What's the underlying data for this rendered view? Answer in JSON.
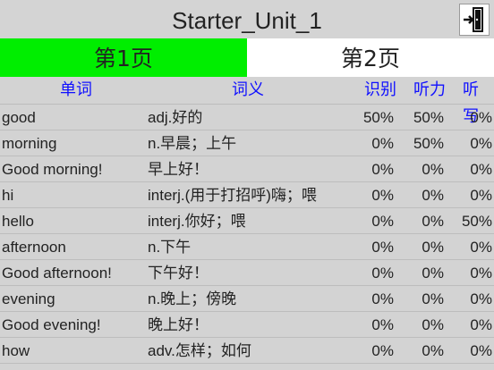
{
  "title": "Starter_Unit_1",
  "tabs": [
    {
      "label": "第1页",
      "active": true
    },
    {
      "label": "第2页",
      "active": false
    }
  ],
  "columns": {
    "word": "单词",
    "meaning": "词义",
    "recognize": "识别",
    "listening": "听力",
    "dictation": "听写"
  },
  "exit_icon": "exit-door-icon",
  "colors": {
    "active_tab": "#00ee00",
    "header_text": "#1010ff",
    "background": "#d3d3d3"
  },
  "rows": [
    {
      "word": "good",
      "meaning": "adj.好的",
      "recognize": "50%",
      "listening": "50%",
      "dictation": "0%"
    },
    {
      "word": "morning",
      "meaning": "n.早晨；上午",
      "recognize": "0%",
      "listening": "50%",
      "dictation": "0%"
    },
    {
      "word": "Good morning!",
      "meaning": "早上好！",
      "recognize": "0%",
      "listening": "0%",
      "dictation": "0%"
    },
    {
      "word": "hi",
      "meaning": "interj.(用于打招呼)嗨；喂",
      "recognize": "0%",
      "listening": "0%",
      "dictation": "0%"
    },
    {
      "word": "hello",
      "meaning": "interj.你好；喂",
      "recognize": "0%",
      "listening": "0%",
      "dictation": "50%"
    },
    {
      "word": "afternoon",
      "meaning": "n.下午",
      "recognize": "0%",
      "listening": "0%",
      "dictation": "0%"
    },
    {
      "word": "Good afternoon!",
      "meaning": "下午好！",
      "recognize": "0%",
      "listening": "0%",
      "dictation": "0%"
    },
    {
      "word": "evening",
      "meaning": "n.晚上；傍晚",
      "recognize": "0%",
      "listening": "0%",
      "dictation": "0%"
    },
    {
      "word": "Good evening!",
      "meaning": "晚上好！",
      "recognize": "0%",
      "listening": "0%",
      "dictation": "0%"
    },
    {
      "word": "how",
      "meaning": "adv.怎样；如何",
      "recognize": "0%",
      "listening": "0%",
      "dictation": "0%"
    }
  ]
}
